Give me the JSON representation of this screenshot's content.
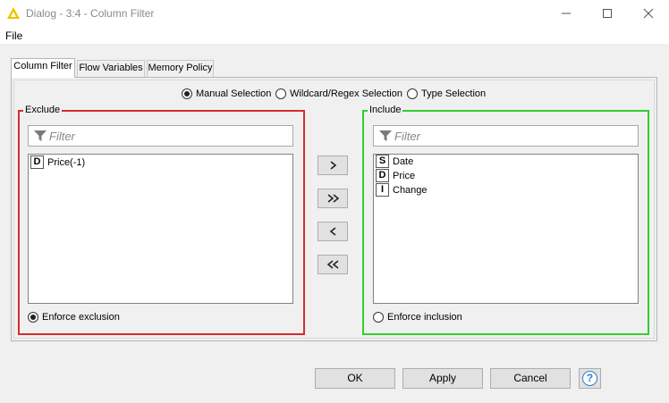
{
  "window": {
    "title": "Dialog - 3:4 - Column Filter"
  },
  "menu": {
    "file": "File"
  },
  "tabs": [
    {
      "label": "Column Filter",
      "active": true
    },
    {
      "label": "Flow Variables",
      "active": false
    },
    {
      "label": "Memory Policy",
      "active": false
    }
  ],
  "selection_mode": {
    "options": [
      "Manual Selection",
      "Wildcard/Regex Selection",
      "Type Selection"
    ],
    "selected": "Manual Selection"
  },
  "exclude": {
    "title": "Exclude",
    "filter_placeholder": "Filter",
    "items": [
      {
        "type": "D",
        "name": "Price(-1)"
      }
    ],
    "enforce_label": "Enforce exclusion",
    "enforce_checked": true
  },
  "include": {
    "title": "Include",
    "filter_placeholder": "Filter",
    "items": [
      {
        "type": "S",
        "name": "Date"
      },
      {
        "type": "D",
        "name": "Price"
      },
      {
        "type": "I",
        "name": "Change"
      }
    ],
    "enforce_label": "Enforce inclusion",
    "enforce_checked": false
  },
  "buttons": {
    "ok": "OK",
    "apply": "Apply",
    "cancel": "Cancel",
    "help": "?"
  },
  "colors": {
    "exclude_border": "#d42c2c",
    "include_border": "#33cc33",
    "title_icon": "#f2c200",
    "help_accent": "#2a7bd6"
  }
}
